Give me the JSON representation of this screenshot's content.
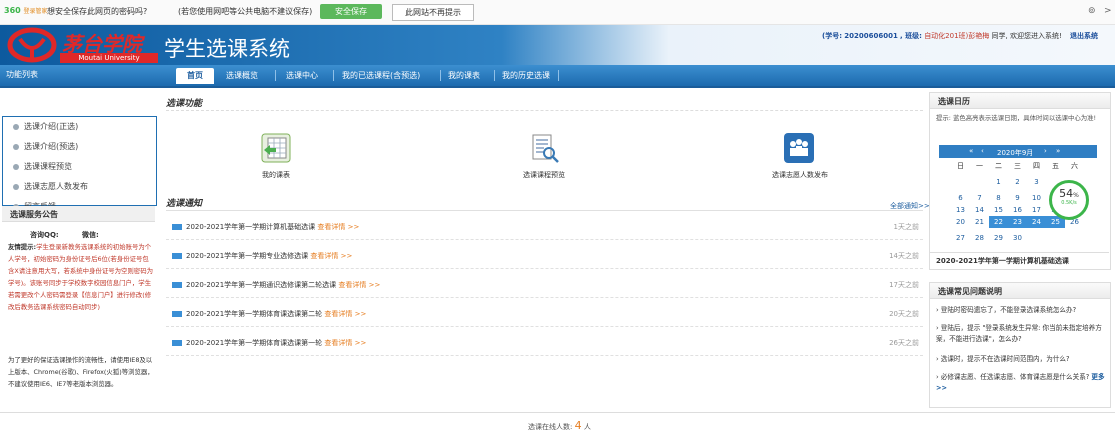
{
  "pwbar": {
    "logo": "360",
    "logo_sub": "登录管家",
    "ask": "想安全保存此网页的密码吗?",
    "note": "(若您使用网吧等公共电脑不建议保存)",
    "save_label": "安全保存",
    "never_label": "此网站不再提示",
    "settings_icon": "settings-icon",
    "close_icon": "close-icon"
  },
  "header": {
    "university_cn": "茅台学院",
    "university_en": "Moutai University",
    "system_title": "学生选课系统",
    "student_no_label": "(学号:",
    "student_no": "20200606001",
    "class_label": ", 班级:",
    "class_name": "自动化201班)彭艳梅",
    "greeting": "同学, 欢迎您进入系统!",
    "logout": "退出系统"
  },
  "nav": {
    "function_list": "功能列表",
    "tabs": [
      "首页",
      "选课概览",
      "选课中心",
      "我的已选课程(含预选)",
      "我的课表",
      "我的历史选课"
    ]
  },
  "menu": {
    "items": [
      "选课介绍(正选)",
      "选课介绍(预选)",
      "选课课程预览",
      "选课志愿人数发布",
      "留言反馈"
    ]
  },
  "announcement": {
    "title": "选课服务公告",
    "qq_label": "咨询QQ:",
    "wx_label": "微信:",
    "warm_label": "友情提示:",
    "body": "学生登录新教务选课系统的初始账号为个人学号，初始密码为身份证号后6位(若身份证号包含X请注意用大写，若系统中身份证号为空则密码为学号)。该账号同步于学校数字校园信息门户，学生若需更改个人密码需登录【信息门户】进行修改(修改后教务选课系统密码自动同步)",
    "body2": "为了更好的保证选课操作的流畅性，请使用IE8及以上版本、Chrome(谷歌)、Firefox(火狐)等浏览器，不建议使用IE6、IE7等老版本浏览器。"
  },
  "features": {
    "title": "选课功能",
    "items": [
      {
        "label": "我的课表",
        "icon": "timetable-icon"
      },
      {
        "label": "选课课程预览",
        "icon": "course-preview-icon"
      },
      {
        "label": "选课志愿人数发布",
        "icon": "volunteers-icon"
      }
    ]
  },
  "notices": {
    "title": "选课通知",
    "all_link": "全部通知>>",
    "detail_label": "查看详情 >>",
    "items": [
      {
        "text": "2020-2021学年第一学期计算机基础选课",
        "ago": "1天之前"
      },
      {
        "text": "2020-2021学年第一学期专业选修选课",
        "ago": "14天之前"
      },
      {
        "text": "2020-2021学年第一学期通识选修课第二轮选课",
        "ago": "17天之前"
      },
      {
        "text": "2020-2021学年第一学期体育课选课第二轮",
        "ago": "20天之前"
      },
      {
        "text": "2020-2021学年第一学期体育课选课第一轮",
        "ago": "26天之前"
      }
    ]
  },
  "calendar": {
    "title": "选课日历",
    "tip": "提示: 蓝色高亮表示选课日期，具体时间以选课中心为准!",
    "month_label": "2020年9月",
    "weekdays": [
      "日",
      "一",
      "二",
      "三",
      "四",
      "五",
      "六"
    ],
    "rows": [
      [
        "",
        "",
        "1",
        "2",
        "3",
        "",
        ""
      ],
      [
        "6",
        "7",
        "8",
        "9",
        "10",
        "",
        ""
      ],
      [
        "13",
        "14",
        "15",
        "16",
        "17",
        "18",
        "19"
      ],
      [
        "20",
        "21",
        "22",
        "23",
        "24",
        "25",
        "26"
      ],
      [
        "27",
        "28",
        "29",
        "30",
        "",
        "",
        ""
      ]
    ],
    "highlighted": [
      "22",
      "23",
      "24",
      "25"
    ],
    "event": "2020-2021学年第一学期计算机基础选课",
    "speed_value": "54",
    "speed_unit": "%",
    "speed_rate": "0.5K/s"
  },
  "faq": {
    "title": "选课常见问题说明",
    "items": [
      "登陆时密码遗忘了，不能登录选课系统怎么办?",
      "登陆后，提示 \"登录系统发生异常: 你当前未指定培养方案，不能进行选课\"，怎么办?",
      "选课时，提示不在选课时间范围内，为什么?",
      "必修课志愿、任选课志愿、体育课志愿是什么关系?"
    ],
    "more": "更多>>"
  },
  "footer": {
    "online_label": "选课在线人数:",
    "online_count": "4",
    "online_unit": "人"
  }
}
